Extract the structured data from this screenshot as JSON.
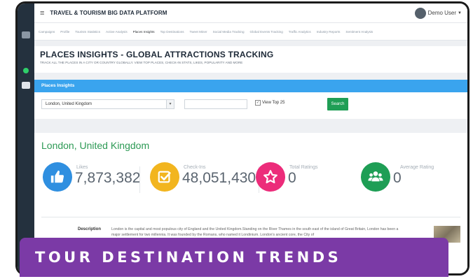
{
  "topbar": {
    "brand": "TRAVEL & TOURISM BIG DATA PLATFORM",
    "user": "Demo User"
  },
  "nav": {
    "tabs": [
      {
        "label": "Campaigns"
      },
      {
        "label": "Profile"
      },
      {
        "label": "Tourism Statistics"
      },
      {
        "label": "Active Analysis"
      },
      {
        "label": "Places Insights",
        "active": true
      },
      {
        "label": "Top Destinations"
      },
      {
        "label": "Tweet Miner"
      },
      {
        "label": "Social Media Tracking"
      },
      {
        "label": "Global Events Tracking"
      },
      {
        "label": "Traffic Analytics"
      },
      {
        "label": "Industry Reports"
      },
      {
        "label": "Sentiment Analysis"
      }
    ]
  },
  "header": {
    "title": "PLACES INSIGHTS - GLOBAL ATTRACTIONS TRACKING",
    "subtitle": "TRACK ALL THE PLACES IN A CITY OR COUNTRY GLOBALLY. VIEW TOP PLACES, CHECK-IN STATS, LIKES, POPULARITY AND MORE"
  },
  "panel": {
    "title": "Places Insights"
  },
  "search": {
    "location_value": "London, United Kingdom",
    "text_value": "",
    "view_top_label": "View Top 25",
    "view_top_checked": true,
    "button_label": "Search"
  },
  "result": {
    "city": "London, United Kingdom",
    "stats": [
      {
        "label": "Likes",
        "value": "7,873,382",
        "color": "#2f8fe0",
        "icon": "thumbs-up-icon"
      },
      {
        "label": "Check-Ins",
        "value": "48,051,430",
        "color": "#f2b51f",
        "icon": "check-square-icon"
      },
      {
        "label": "Total Ratings",
        "value": "0",
        "color": "#ec2c7a",
        "icon": "star-icon"
      },
      {
        "label": "Average Rating",
        "value": "0",
        "color": "#1e9e55",
        "icon": "users-icon"
      }
    ],
    "description_label": "Description",
    "description": "London is the capital and most populous city of England and the United Kingdom.Standing on the River Thames in the south east of the island of Great Britain, London has been a major settlement for two millennia. It was founded by the Romans, who named it Londinium. London's ancient core, the City of"
  },
  "banner": {
    "text": "TOUR DESTINATION TRENDS"
  }
}
